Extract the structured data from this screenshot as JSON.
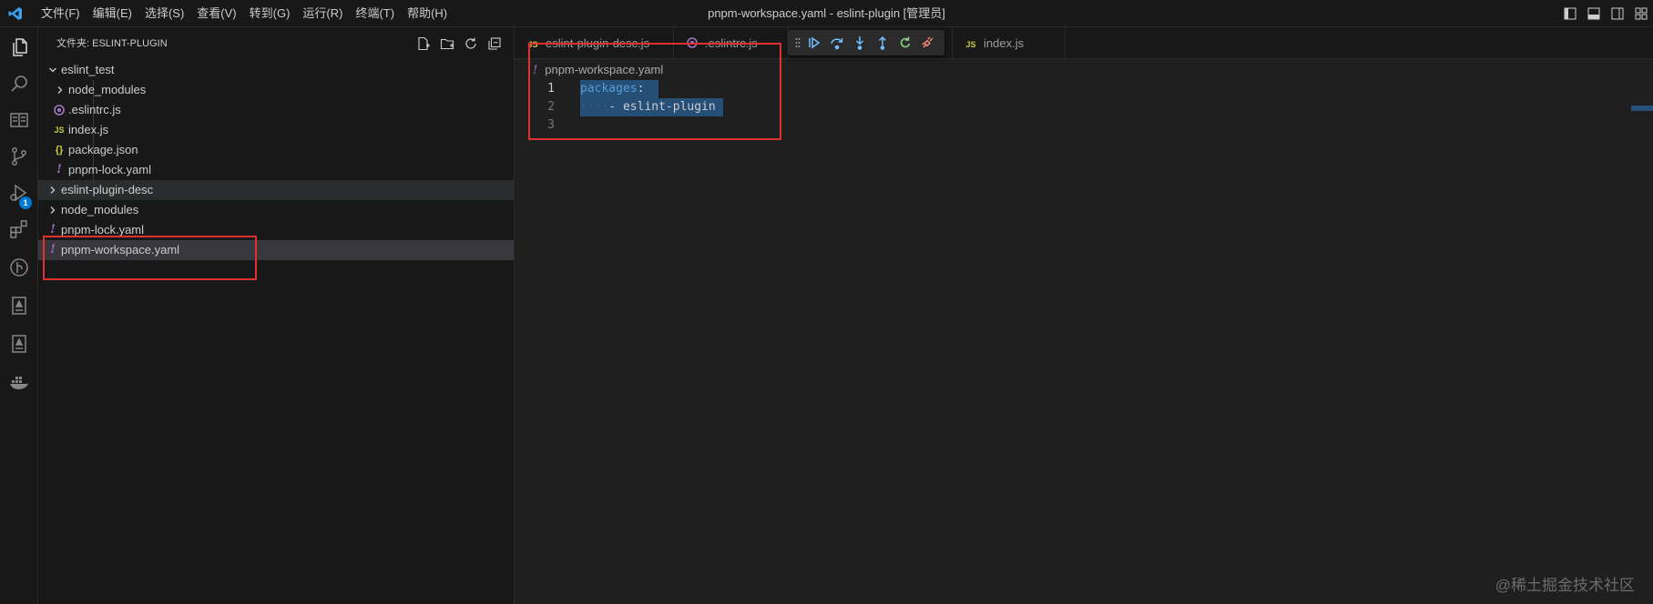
{
  "titlebar": {
    "menus": [
      "文件(F)",
      "编辑(E)",
      "选择(S)",
      "查看(V)",
      "转到(G)",
      "运行(R)",
      "终端(T)",
      "帮助(H)"
    ],
    "window_title": "pnpm-workspace.yaml - eslint-plugin [管理员]"
  },
  "activitybar": {
    "icons": [
      "explorer-icon",
      "search-icon",
      "book-icon",
      "source-control-icon",
      "run-debug-icon",
      "extensions-icon",
      "git-graph-icon",
      "remote-icon",
      "remote2-icon",
      "docker-icon"
    ],
    "debug_badge": "1"
  },
  "sidebar": {
    "title": "文件夹: ESLINT-PLUGIN",
    "tree": [
      {
        "label": "eslint_test",
        "type": "folder-open"
      },
      {
        "label": "node_modules",
        "type": "folder"
      },
      {
        "label": ".eslintrc.js",
        "type": "eslint"
      },
      {
        "label": "index.js",
        "type": "js"
      },
      {
        "label": "package.json",
        "type": "json"
      },
      {
        "label": "pnpm-lock.yaml",
        "type": "yaml"
      },
      {
        "label": "eslint-plugin-desc",
        "type": "folder"
      },
      {
        "label": "node_modules",
        "type": "folder"
      },
      {
        "label": "pnpm-lock.yaml",
        "type": "yaml"
      },
      {
        "label": "pnpm-workspace.yaml",
        "type": "yaml"
      }
    ]
  },
  "icons": {
    "js": "JS",
    "json": "{}",
    "yaml": "!"
  },
  "editor": {
    "tabs": [
      {
        "label": "eslint-plugin-desc.js",
        "icon": "JS"
      },
      {
        "label": ".eslintrc.js",
        "icon": "eslint"
      },
      {
        "label": "index.js",
        "icon": "JS"
      }
    ],
    "breadcrumb": "pnpm-workspace.yaml",
    "lines": [
      {
        "number": "1",
        "key": "packages",
        "colon": ":"
      },
      {
        "number": "2",
        "indent": "····",
        "dash": "- ",
        "value": "eslint-plugin"
      },
      {
        "number": "3"
      }
    ]
  },
  "watermark": "@稀土掘金技术社区",
  "colors": {
    "accent": "#0078d4",
    "selection": "#264f78",
    "annotation_red": "#e03131"
  }
}
